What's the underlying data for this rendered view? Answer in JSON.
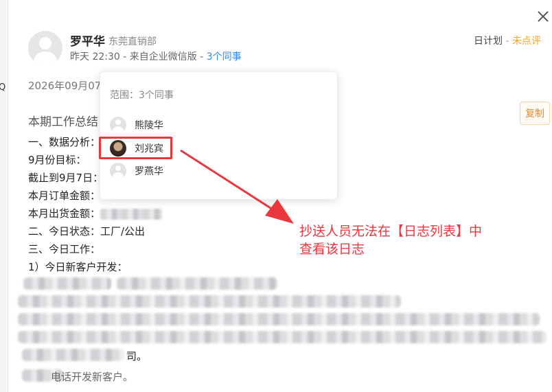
{
  "header": {
    "author": "罗平华",
    "department": "东莞直销部",
    "meta_prefix": "昨天 22:30 - 来自企业微信版 - ",
    "colleagues_link": "3个同事",
    "plan_type": "日计划",
    "plan_sep": " - ",
    "plan_status": "未点评"
  },
  "report": {
    "date": "2026年09月07日",
    "section_title": "本期工作总结",
    "copy_label": "复制",
    "lines": {
      "data_analysis": "一、数据分析：",
      "monthly_target": "9月份目标：",
      "as_of": "截止到9月7日：",
      "order_amount": "本月订单金额：",
      "shipment_amount": " 本月出货金额：",
      "today_status": "二、今日状态：工厂/公出",
      "today_work": "三、今日工作：",
      "new_clients": "1）今日新客户开发：",
      "partial_line_1_end": "司。",
      "partial_line_2_end": "电话开发新客户。"
    }
  },
  "popover": {
    "range_label": "范围：3个同事",
    "members": [
      {
        "name": "熊陵华"
      },
      {
        "name": "刘兆宾"
      },
      {
        "name": "罗燕华"
      }
    ]
  },
  "annotation": {
    "line1": "抄送人员无法在【日志列表】中",
    "line2": "查看该日志"
  },
  "icons": {
    "close": "close-icon",
    "avatar": "user-avatar-icon"
  },
  "colors": {
    "link": "#2d8cf0",
    "status": "#f5a623",
    "annotation": "#e8383d",
    "copy": "#e8892e"
  }
}
